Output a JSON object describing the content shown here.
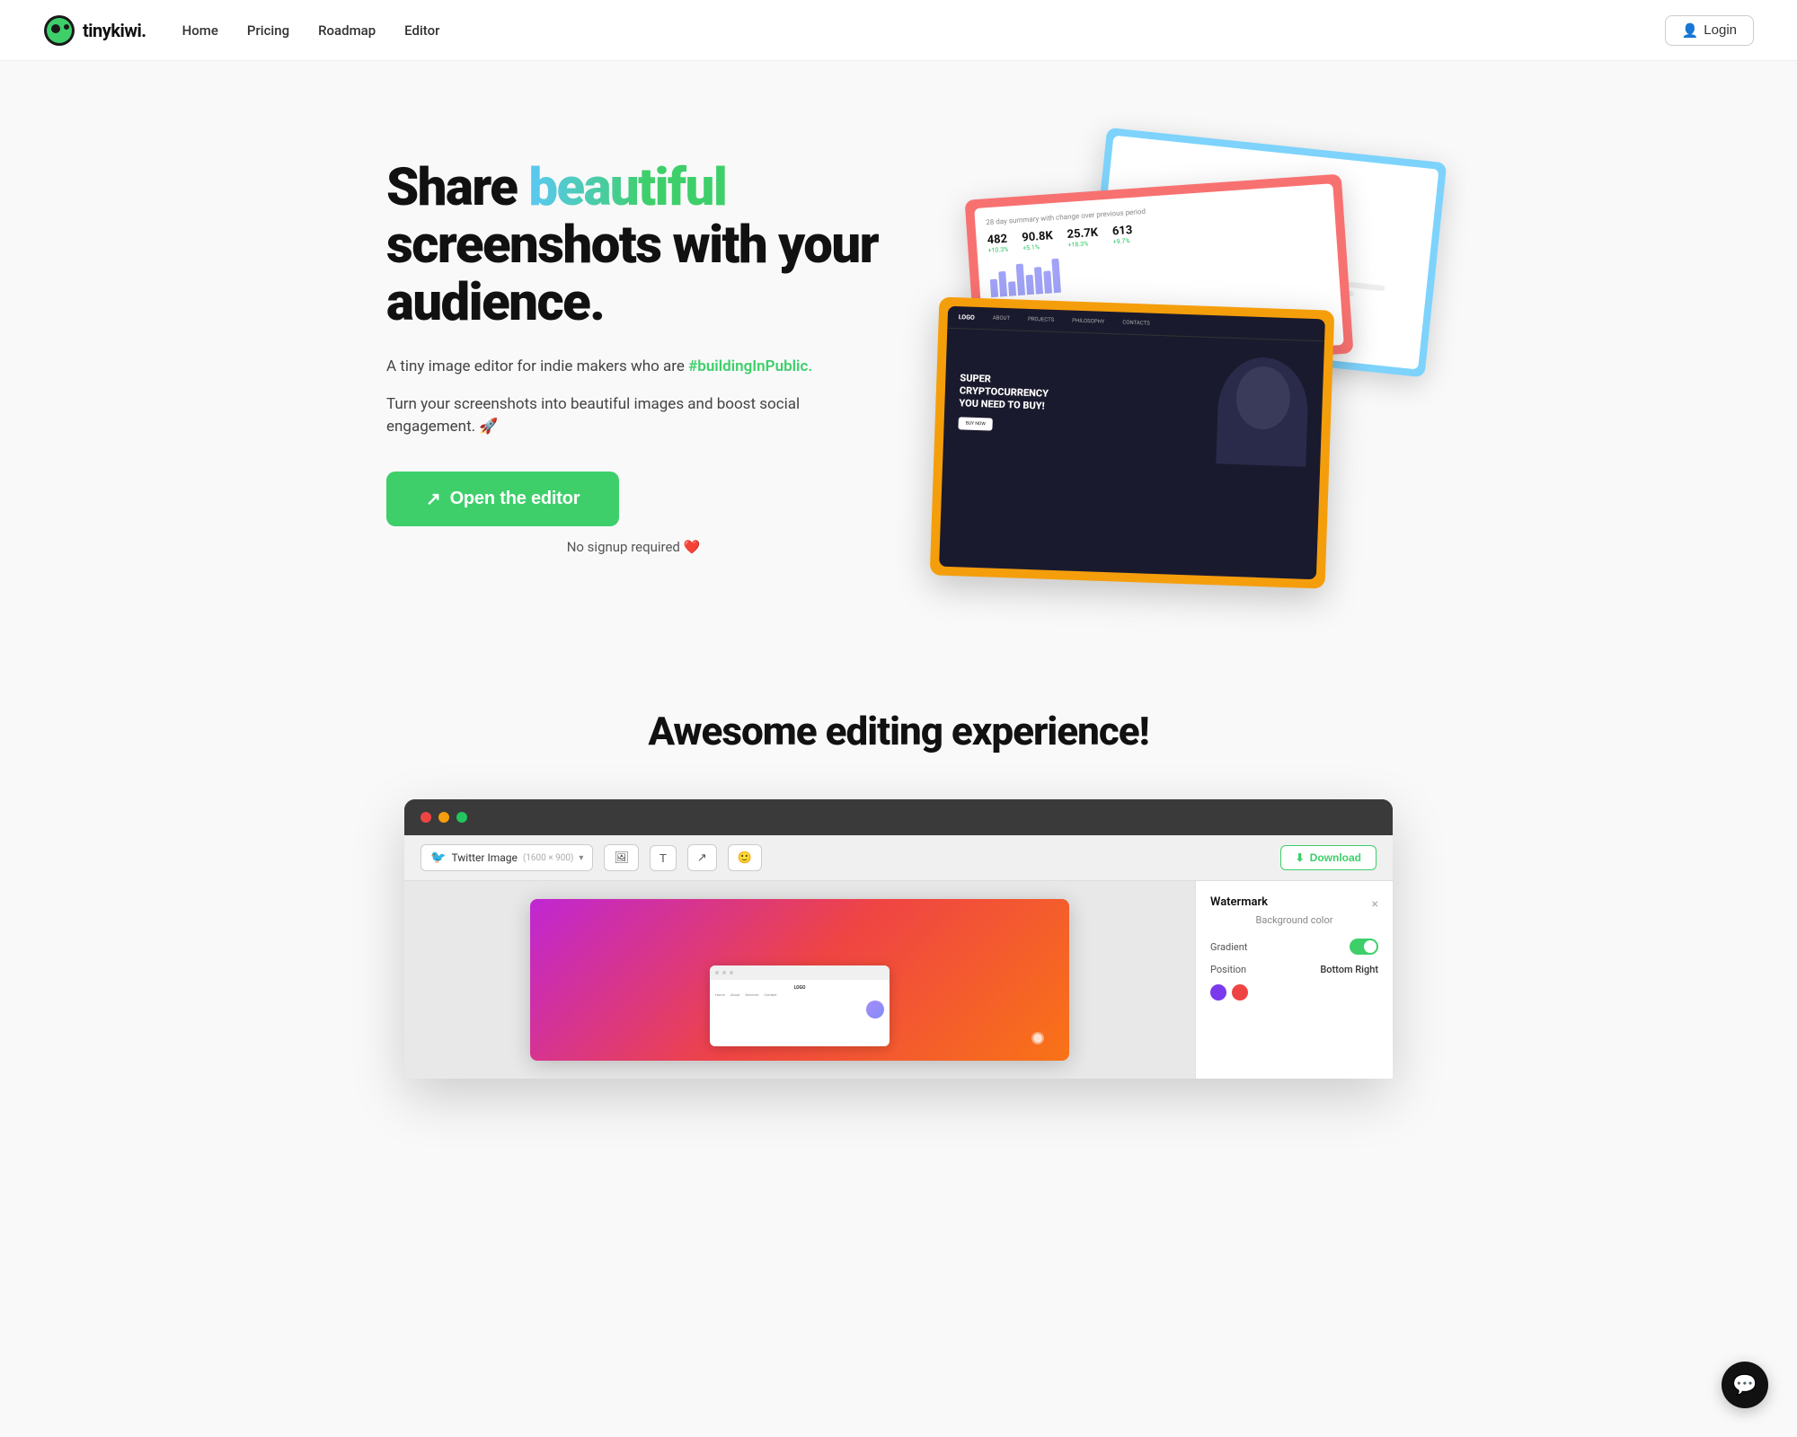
{
  "nav": {
    "logo_text": "tinykiwi.",
    "links": [
      {
        "label": "Home",
        "id": "home"
      },
      {
        "label": "Pricing",
        "id": "pricing"
      },
      {
        "label": "Roadmap",
        "id": "roadmap"
      },
      {
        "label": "Editor",
        "id": "editor"
      }
    ],
    "login_label": "Login"
  },
  "hero": {
    "heading_start": "Share ",
    "heading_highlight": "beautiful",
    "heading_end": " screenshots with your audience.",
    "sub1": "A tiny image editor for indie makers who are",
    "hashtag": "#buildingInPublic.",
    "sub2": "Turn your screenshots into beautiful images and boost social engagement. 🚀",
    "cta_label": "Open the editor",
    "cta_icon": "↗",
    "no_signup": "No signup required ❤️"
  },
  "section2": {
    "title": "Awesome editing experience!"
  },
  "editor_mockup": {
    "toolbar": {
      "select_label": "Twitter Image",
      "select_size": "(1600 × 900)",
      "icon_image": "🖼",
      "icon_text": "T",
      "icon_shapes": "↗",
      "icon_emoji": "🙂",
      "download_label": "Download"
    },
    "panel": {
      "close_icon": "×",
      "title": "Watermark",
      "subtitle": "Background color",
      "gradient_label": "Gradient",
      "gradient_on": true,
      "position_label": "Position",
      "position_value": "Bottom Right",
      "color1": "#7c3aed",
      "color2": "#ef4444"
    }
  },
  "cards": {
    "stats": {
      "title": "28 day summary",
      "metric1_num": "482",
      "metric1_change": "+10.3%",
      "metric2_num": "90.8K",
      "metric2_change": "+5.1%",
      "metric3_num": "25.7K",
      "metric3_change": "+18.3%",
      "metric4_num": "613",
      "metric4_change": "+9.7%"
    },
    "crypto": {
      "heading1": "SUPER CRYPTOCURRENCY",
      "heading2": "YOU NEED TO BUY!",
      "cta": "BUY NOW"
    }
  }
}
